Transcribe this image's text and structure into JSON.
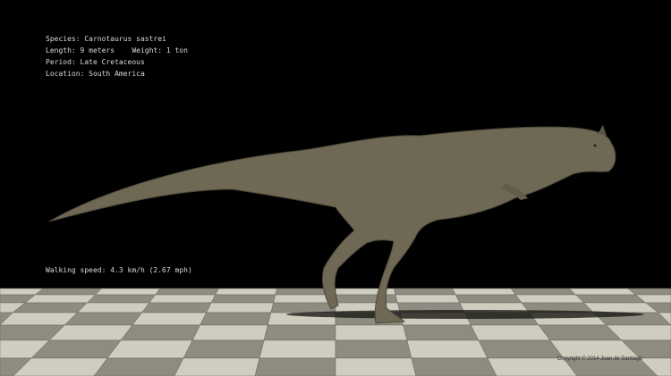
{
  "specs": {
    "species": "Species: Carnotaurus sastrei",
    "length": "Length: 9 meters",
    "weight": "Weight: 1 ton",
    "period": "Period: Late Cretaceous",
    "location": "Location: South America"
  },
  "walking_speed": "Walking speed: 4.3 km/h (2.67 mph)",
  "copyright": "Copyright © 2014 Juan de Santiago",
  "colors": {
    "background": "#000000",
    "tile_light": "#cfcdc0",
    "tile_dark": "#8e8c80",
    "dino": "#6e6855"
  }
}
